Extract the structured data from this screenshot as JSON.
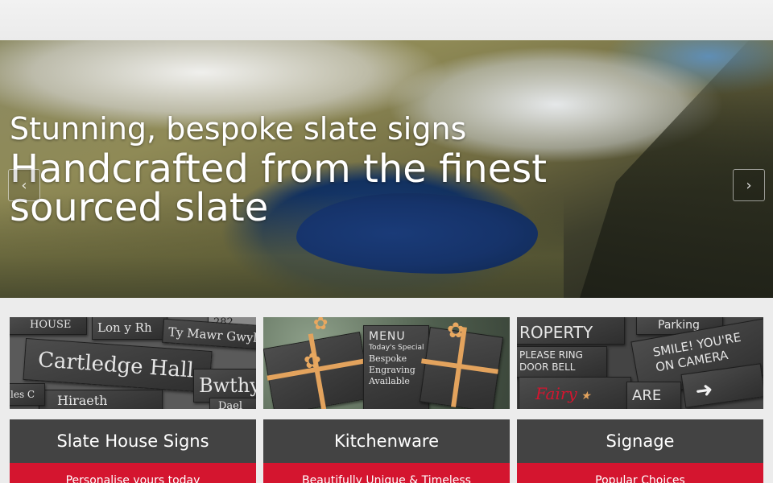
{
  "hero": {
    "subtitle": "Stunning, bespoke slate signs",
    "headline": "Handcrafted from the finest sourced slate",
    "prev_label": "‹",
    "next_label": "›"
  },
  "cards": [
    {
      "title": "Slate House Signs",
      "subtitle": "Personalise yours today",
      "image_text": [
        "HOUSE",
        "Lon y Rh",
        "282",
        "Ty Mawr Gwyl",
        "Cartledge Hall",
        "Bwthy",
        "Hiraeth",
        "les C",
        "Dael"
      ]
    },
    {
      "title": "Kitchenware",
      "subtitle": "Beautifully Unique & Timeless",
      "image_text": [
        "MENU",
        "Today's Special",
        "Bespoke",
        "Engraving",
        "Available"
      ]
    },
    {
      "title": "Signage",
      "subtitle": "Popular Choices",
      "image_text": [
        "ROPERTY",
        "Parking",
        "PLEASE RING",
        "DOOR BELL",
        "SMILE! YOU'RE",
        "ON CAMERA",
        "Fairy",
        "ARE"
      ]
    }
  ],
  "colors": {
    "card_title_bg": "#434343",
    "card_band_bg": "#d4152f",
    "page_bg": "#ececec"
  }
}
